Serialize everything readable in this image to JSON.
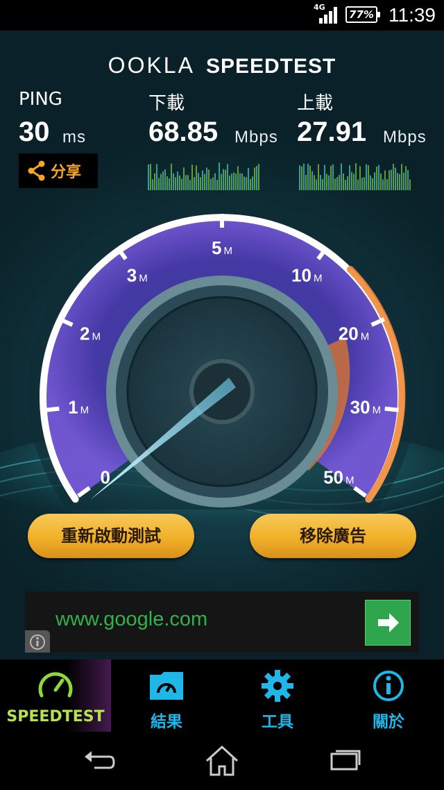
{
  "status_bar": {
    "network": "4G",
    "battery": "77%",
    "time": "11:39"
  },
  "header": {
    "brand": "OOKLA",
    "product": "SPEEDTEST"
  },
  "ping": {
    "label": "PING",
    "value": "30",
    "unit": "ms"
  },
  "download": {
    "label": "下載",
    "value": "68.85",
    "unit": "Mbps"
  },
  "upload": {
    "label": "上載",
    "value": "27.91",
    "unit": "Mbps"
  },
  "share": {
    "label": "分享",
    "icon": "share-icon"
  },
  "gauge": {
    "ticks": [
      {
        "num": "0",
        "unit": ""
      },
      {
        "num": "1",
        "unit": "M"
      },
      {
        "num": "2",
        "unit": "M"
      },
      {
        "num": "3",
        "unit": "M"
      },
      {
        "num": "5",
        "unit": "M"
      },
      {
        "num": "10",
        "unit": "M"
      },
      {
        "num": "20",
        "unit": "M"
      },
      {
        "num": "30",
        "unit": "M"
      },
      {
        "num": "50",
        "unit": "M"
      }
    ],
    "colors": {
      "ring": "#ffffff",
      "purple": "#7a4fd8",
      "orange": "#e07a2a",
      "needle": "#9fe8ff"
    }
  },
  "buttons": {
    "restart": "重新啟動測試",
    "remove_ads": "移除廣告"
  },
  "ad": {
    "text": "www.google.com",
    "go_icon": "arrow-right-icon",
    "info_icon": "info-icon"
  },
  "tabs": [
    {
      "label": "SPEEDTEST",
      "icon": "speedometer-icon",
      "active": true
    },
    {
      "label": "結果",
      "icon": "results-folder-icon",
      "active": false
    },
    {
      "label": "工具",
      "icon": "gear-icon",
      "active": false
    },
    {
      "label": "關於",
      "icon": "info-icon",
      "active": false
    }
  ],
  "colors": {
    "accent_blue": "#1fb6e8",
    "accent_green": "#b5e34b",
    "button_gold": "#f0b029"
  }
}
